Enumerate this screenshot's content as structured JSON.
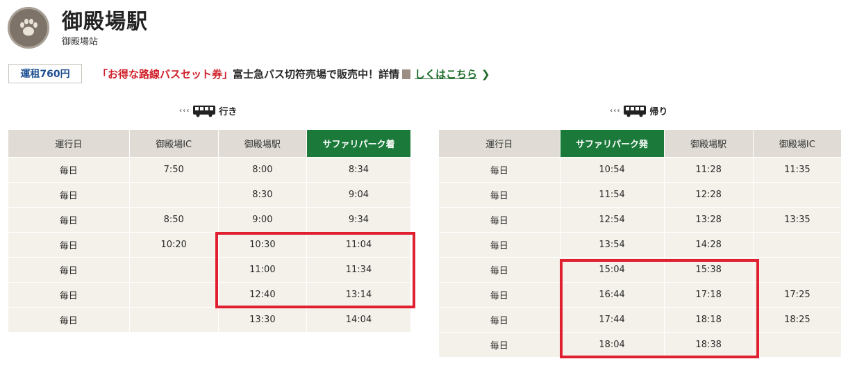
{
  "header": {
    "logo_icon": "paw-icon",
    "station_name": "御殿場駅",
    "station_name_sub": "御殿場站"
  },
  "fare": {
    "label": "運租760円"
  },
  "notice": {
    "red_text": "「お得な路線バスセット券」",
    "text": "富士急バス切符売場で販売中！詳情",
    "link_text": "しくはこちら",
    "chevron": "❯"
  },
  "outbound": {
    "direction_arrows": "‹‹‹",
    "direction_label": "行き",
    "headers": [
      "運行日",
      "御殿場IC",
      "御殿場駅",
      "サファリパーク着"
    ],
    "rows": [
      [
        "毎日",
        "7:50",
        "8:00",
        "8:34"
      ],
      [
        "毎日",
        "",
        "8:30",
        "9:04"
      ],
      [
        "毎日",
        "8:50",
        "9:00",
        "9:34"
      ],
      [
        "毎日",
        "10:20",
        "10:30",
        "11:04"
      ],
      [
        "毎日",
        "",
        "11:00",
        "11:34"
      ],
      [
        "毎日",
        "",
        "12:40",
        "13:14"
      ],
      [
        "毎日",
        "",
        "13:30",
        "14:04"
      ]
    ]
  },
  "inbound": {
    "direction_arrows": "‹‹‹",
    "direction_label": "帰り",
    "headers": [
      "運行日",
      "サファリパーク発",
      "御殿場駅",
      "御殿場IC"
    ],
    "rows": [
      [
        "毎日",
        "10:54",
        "11:28",
        "11:35"
      ],
      [
        "毎日",
        "11:54",
        "12:28",
        ""
      ],
      [
        "毎日",
        "12:54",
        "13:28",
        "13:35"
      ],
      [
        "毎日",
        "13:54",
        "14:28",
        ""
      ],
      [
        "毎日",
        "15:04",
        "15:38",
        ""
      ],
      [
        "毎日",
        "16:44",
        "17:18",
        "17:25"
      ],
      [
        "毎日",
        "17:44",
        "18:18",
        "18:25"
      ],
      [
        "毎日",
        "18:04",
        "18:38",
        ""
      ]
    ]
  },
  "colors": {
    "highlight_header": "#1b7a3a",
    "annotation_box": "#e02030",
    "notice_red": "#d0202a",
    "link_green": "#1f6b2b",
    "fare_blue": "#1d4f91"
  }
}
